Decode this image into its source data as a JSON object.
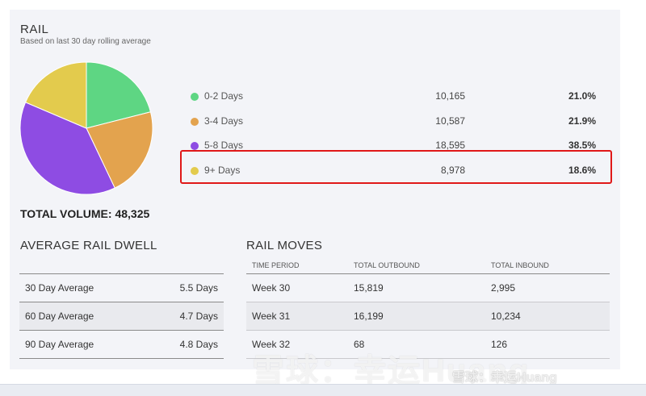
{
  "header": {
    "title": "RAIL",
    "subtitle": "Based on last 30 day rolling average"
  },
  "total": "TOTAL VOLUME: 48,325",
  "legend": [
    {
      "label": "0-2 Days",
      "count": "10,165",
      "pct": "21.0%",
      "color": "#5ed683"
    },
    {
      "label": "3-4 Days",
      "count": "10,587",
      "pct": "21.9%",
      "color": "#e3a34e"
    },
    {
      "label": "5-8 Days",
      "count": "18,595",
      "pct": "38.5%",
      "color": "#8e4ce3"
    },
    {
      "label": "9+ Days",
      "count": "8,978",
      "pct": "18.6%",
      "color": "#e3cb4d"
    }
  ],
  "chart_data": {
    "type": "pie",
    "categories": [
      "0-2 Days",
      "3-4 Days",
      "5-8 Days",
      "9+ Days"
    ],
    "values": [
      10165,
      10587,
      18595,
      8978
    ],
    "colors": [
      "#5ed683",
      "#e3a34e",
      "#8e4ce3",
      "#e3cb4d"
    ],
    "title": "RAIL",
    "subtitle": "Based on last 30 day rolling average"
  },
  "dwell": {
    "title": "AVERAGE RAIL DWELL",
    "rows": [
      {
        "label": "30 Day Average",
        "value": "5.5 Days"
      },
      {
        "label": "60 Day Average",
        "value": "4.7 Days"
      },
      {
        "label": "90 Day Average",
        "value": "4.8 Days"
      }
    ]
  },
  "moves": {
    "title": "RAIL MOVES",
    "columns": [
      "TIME PERIOD",
      "TOTAL OUTBOUND",
      "TOTAL INBOUND"
    ],
    "rows": [
      [
        "Week 30",
        "15,819",
        "2,995"
      ],
      [
        "Week 31",
        "16,199",
        "10,234"
      ],
      [
        "Week 32",
        "68",
        "126"
      ]
    ]
  },
  "watermark": {
    "large": "雪球：幸运Huang",
    "small": "雪球：幸运Huang"
  }
}
